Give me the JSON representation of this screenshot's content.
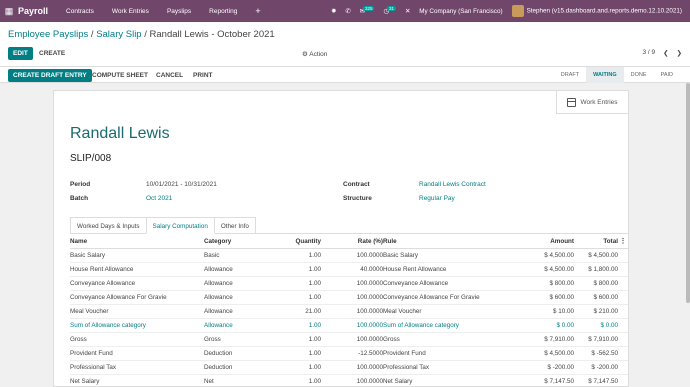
{
  "topbar": {
    "app_name": "Payroll",
    "menus": [
      "Contracts",
      "Work Entries",
      "Payslips",
      "Reporting"
    ],
    "plus_label": "+",
    "messages_count": "325",
    "activities_count": "31",
    "company": "My Company (San Francisco)",
    "user": "Stephen (v15.dashboard.and.reports.demo.12.10.2021)"
  },
  "breadcrumb": {
    "parent": "Employee Payslips",
    "middle": "Salary Slip",
    "current": "Randall Lewis - October 2021"
  },
  "control": {
    "edit_label": "EDIT",
    "create_label": "CREATE",
    "action_label": "Action",
    "pager": "3 / 9"
  },
  "statusbar": {
    "buttons": [
      "CREATE DRAFT ENTRY",
      "COMPUTE SHEET",
      "CANCEL",
      "PRINT"
    ],
    "stages": [
      "DRAFT",
      "WAITING",
      "DONE",
      "PAID"
    ],
    "active_stage": "WAITING"
  },
  "form": {
    "work_entries_label": "Work Entries",
    "employee": "Randall Lewis",
    "reference": "SLIP/008",
    "period_label": "Period",
    "period_value": "10/01/2021 - 10/31/2021",
    "batch_label": "Batch",
    "batch_value": "Oct 2021",
    "contract_label": "Contract",
    "contract_value": "Randall Lewis Contract",
    "structure_label": "Structure",
    "structure_value": "Regular Pay"
  },
  "tabs": [
    "Worked Days & Inputs",
    "Salary Computation",
    "Other Info"
  ],
  "active_tab": "Salary Computation",
  "table": {
    "headers": [
      "Name",
      "Category",
      "Quantity",
      "Rate (%)",
      "Rule",
      "Amount",
      "Total"
    ],
    "rows": [
      {
        "name": "Basic Salary",
        "category": "Basic",
        "quantity": "1.00",
        "rate": "100.0000",
        "rule": "Basic Salary",
        "amount": "$ 4,500.00",
        "total": "$ 4,500.00",
        "link": false
      },
      {
        "name": "House Rent Allowance",
        "category": "Allowance",
        "quantity": "1.00",
        "rate": "40.0000",
        "rule": "House Rent Allowance",
        "amount": "$ 4,500.00",
        "total": "$ 1,800.00",
        "link": false
      },
      {
        "name": "Conveyance Allowance",
        "category": "Allowance",
        "quantity": "1.00",
        "rate": "100.0000",
        "rule": "Conveyance Allowance",
        "amount": "$ 800.00",
        "total": "$ 800.00",
        "link": false
      },
      {
        "name": "Conveyance Allowance For Gravie",
        "category": "Allowance",
        "quantity": "1.00",
        "rate": "100.0000",
        "rule": "Conveyance Allowance For Gravie",
        "amount": "$ 600.00",
        "total": "$ 600.00",
        "link": false
      },
      {
        "name": "Meal Voucher",
        "category": "Allowance",
        "quantity": "21.00",
        "rate": "100.0000",
        "rule": "Meal Voucher",
        "amount": "$ 10.00",
        "total": "$ 210.00",
        "link": false
      },
      {
        "name": "Sum of Allowance category",
        "category": "Allowance",
        "quantity": "1.00",
        "rate": "100.0000",
        "rule": "Sum of Allowance category",
        "amount": "$ 0.00",
        "total": "$ 0.00",
        "link": true
      },
      {
        "name": "Gross",
        "category": "Gross",
        "quantity": "1.00",
        "rate": "100.0000",
        "rule": "Gross",
        "amount": "$ 7,910.00",
        "total": "$ 7,910.00",
        "link": false
      },
      {
        "name": "Provident Fund",
        "category": "Deduction",
        "quantity": "1.00",
        "rate": "-12.5000",
        "rule": "Provident Fund",
        "amount": "$ 4,500.00",
        "total": "$ -562.50",
        "link": false
      },
      {
        "name": "Professional Tax",
        "category": "Deduction",
        "quantity": "1.00",
        "rate": "100.0000",
        "rule": "Professional Tax",
        "amount": "$ -200.00",
        "total": "$ -200.00",
        "link": false
      },
      {
        "name": "Net Salary",
        "category": "Net",
        "quantity": "1.00",
        "rate": "100.0000",
        "rule": "Net Salary",
        "amount": "$ 7,147.50",
        "total": "$ 7,147.50",
        "link": false
      }
    ]
  }
}
